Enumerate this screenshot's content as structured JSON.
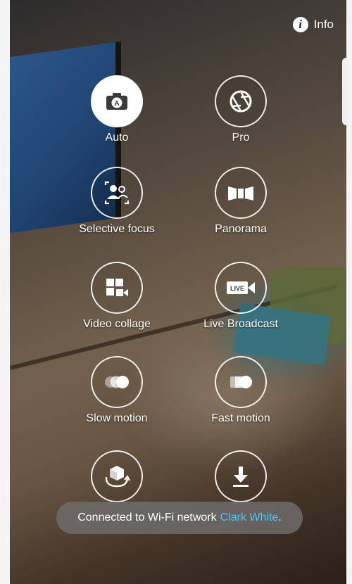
{
  "header": {
    "info_label": "Info"
  },
  "modes": [
    {
      "label": "Auto",
      "icon": "camera-auto-icon",
      "selected": true
    },
    {
      "label": "Pro",
      "icon": "aperture-icon",
      "selected": false
    },
    {
      "label": "Selective focus",
      "icon": "selective-focus-icon",
      "selected": false
    },
    {
      "label": "Panorama",
      "icon": "panorama-icon",
      "selected": false
    },
    {
      "label": "Video collage",
      "icon": "video-collage-icon",
      "selected": false
    },
    {
      "label": "Live Broadcast",
      "icon": "live-broadcast-icon",
      "selected": false
    },
    {
      "label": "Slow motion",
      "icon": "slow-motion-icon",
      "selected": false
    },
    {
      "label": "Fast motion",
      "icon": "fast-motion-icon",
      "selected": false
    },
    {
      "label": "",
      "icon": "virtual-shot-icon",
      "selected": false
    },
    {
      "label": "",
      "icon": "download-icon",
      "selected": false
    }
  ],
  "toast": {
    "message": "Connected to Wi-Fi network",
    "network": "Clark White",
    "suffix": "."
  }
}
